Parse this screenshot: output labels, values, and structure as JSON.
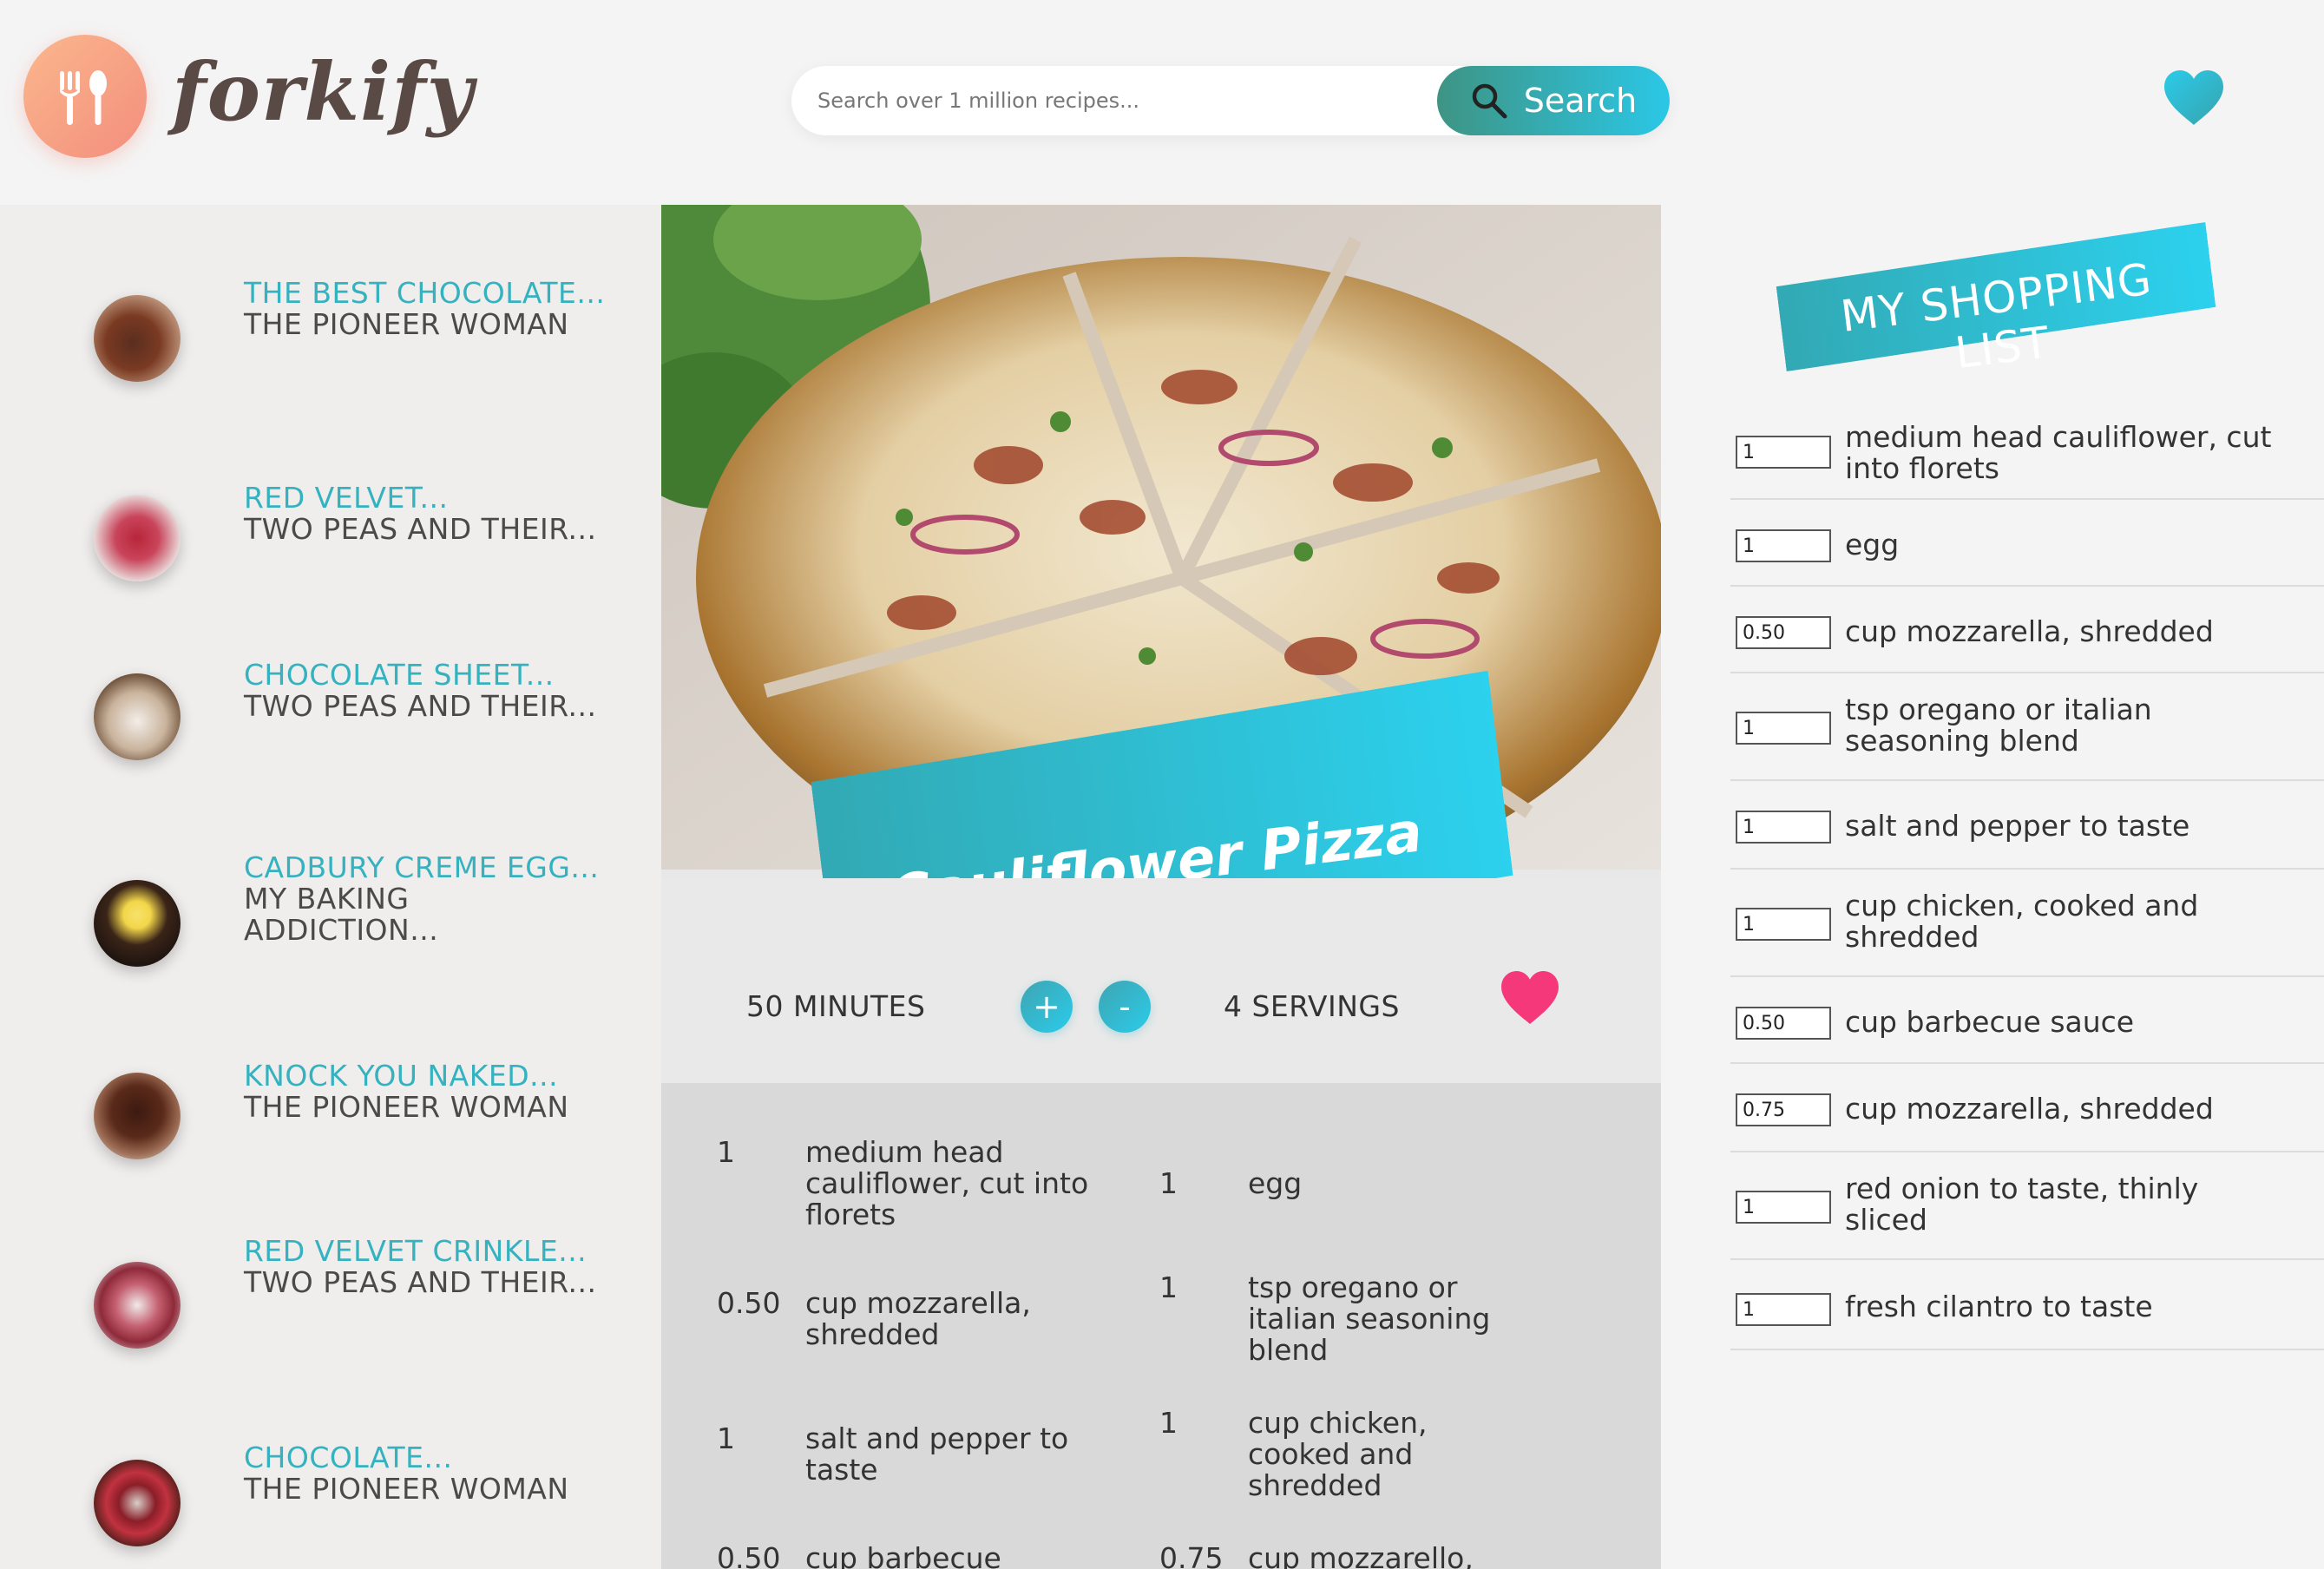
{
  "header": {
    "logo_text": "forkify",
    "search_placeholder": "Search over 1 million recipes...",
    "search_button": "Search"
  },
  "results": [
    {
      "title": "THE BEST CHOCOLATE...",
      "publisher": "THE PIONEER WOMAN"
    },
    {
      "title": "RED VELVET...",
      "publisher": "TWO PEAS AND THEIR..."
    },
    {
      "title": "CHOCOLATE SHEET...",
      "publisher": "TWO PEAS AND THEIR..."
    },
    {
      "title": "CADBURY CREME EGG...",
      "publisher": "MY BAKING ADDICTION..."
    },
    {
      "title": "KNOCK YOU NAKED...",
      "publisher": "THE PIONEER WOMAN"
    },
    {
      "title": "RED VELVET CRINKLE...",
      "publisher": "TWO PEAS AND THEIR..."
    },
    {
      "title": "CHOCOLATE...",
      "publisher": "THE PIONEER WOMAN"
    }
  ],
  "recipe": {
    "title": "Cauliflower Pizza Crust (with BBQ Chicken Pizza)",
    "time": "50 MINUTES",
    "servings": "4 SERVINGS",
    "plus_label": "+",
    "minus_label": "-",
    "ingredients": [
      {
        "qty": "1",
        "text": "  medium head cauliflower, cut into florets"
      },
      {
        "qty": "1",
        "text": "  egg"
      },
      {
        "qty": "0.50",
        "text": "cup   mozzarella, shredded"
      },
      {
        "qty": "1",
        "text": "tsp   oregano or italian seasoning blend"
      },
      {
        "qty": "1",
        "text": "  salt and pepper to taste"
      },
      {
        "qty": "1",
        "text": "cup   chicken, cooked and shredded"
      },
      {
        "qty": "0.50",
        "text": "cup   barbecue"
      },
      {
        "qty": "0.75",
        "text": "cup   mozzarello,"
      }
    ]
  },
  "shopping": {
    "title": "MY SHOPPING LIST",
    "items": [
      {
        "qty": "1",
        "desc": "medium head cauliflower, cut into florets"
      },
      {
        "qty": "1",
        "desc": "egg"
      },
      {
        "qty": "0.50",
        "desc": "cup mozzarella, shredded"
      },
      {
        "qty": "1",
        "desc": "tsp oregano or italian seasoning blend"
      },
      {
        "qty": "1",
        "desc": "salt and pepper to taste"
      },
      {
        "qty": "1",
        "desc": "cup chicken, cooked and shredded"
      },
      {
        "qty": "0.50",
        "desc": "cup barbecue sauce"
      },
      {
        "qty": "0.75",
        "desc": "cup mozzarella, shredded"
      },
      {
        "qty": "1",
        "desc": "red onion to taste, thinly sliced"
      },
      {
        "qty": "1",
        "desc": "fresh cilantro to taste"
      }
    ]
  },
  "colors": {
    "accent": "#2bc7e6",
    "accent_dark": "#35b2bf",
    "heart_pink": "#f5387a",
    "logo_orange": "#f59f84"
  }
}
